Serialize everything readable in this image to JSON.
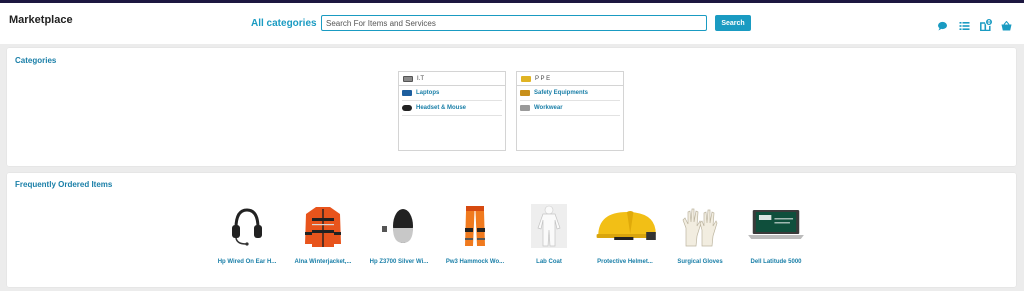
{
  "header": {
    "brand": "Marketplace",
    "all_categories": "All categories",
    "search_placeholder": "Search For Items and Services",
    "search_button": "Search",
    "cart_count": "0"
  },
  "categories_panel": {
    "title": "Categories",
    "groups": [
      {
        "name": "I.T",
        "items": [
          "Laptops",
          "Headset & Mouse"
        ]
      },
      {
        "name": "P P E",
        "items": [
          "Safety Equipments",
          "Workwear"
        ]
      }
    ]
  },
  "frequent_panel": {
    "title": "Frequently Ordered Items",
    "items": [
      {
        "label": "Hp Wired On Ear H...",
        "icon": "headset-image"
      },
      {
        "label": "Alna Winterjacket,...",
        "icon": "winter-jacket-image"
      },
      {
        "label": "Hp Z3700 Silver Wi...",
        "icon": "wireless-mouse-image"
      },
      {
        "label": "Pw3 Hammock Wo...",
        "icon": "work-trousers-image"
      },
      {
        "label": "Lab Coat",
        "icon": "lab-coat-image"
      },
      {
        "label": "Protective Helmet...",
        "icon": "helmet-image"
      },
      {
        "label": "Surgical Gloves",
        "icon": "gloves-image"
      },
      {
        "label": "Dell Latitude 5000",
        "icon": "laptop-image"
      }
    ]
  },
  "colors": {
    "accent": "#1a9bc2",
    "link": "#1a7fa8",
    "top_stripe": "#1c1740"
  }
}
